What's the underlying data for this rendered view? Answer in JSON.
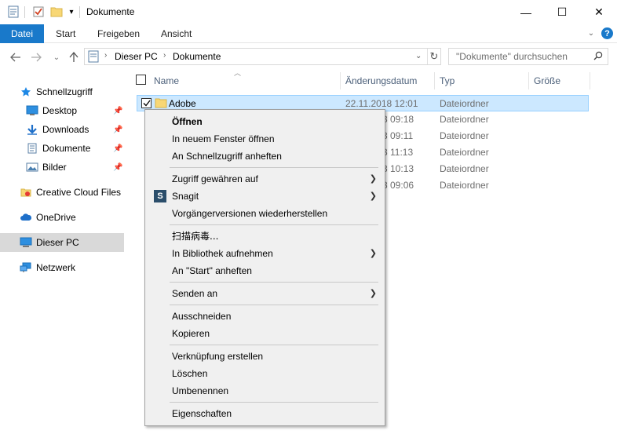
{
  "window": {
    "title": "Dokumente",
    "minimize": "—",
    "maximize": "☐",
    "close": "✕"
  },
  "ribbon": {
    "file": "Datei",
    "tabs": [
      "Start",
      "Freigeben",
      "Ansicht"
    ],
    "help": "?"
  },
  "address": {
    "segments": [
      "Dieser PC",
      "Dokumente"
    ],
    "search_placeholder": "\"Dokumente\" durchsuchen"
  },
  "sidebar": {
    "items": [
      {
        "label": "Schnellzugriff",
        "icon": "star-icon"
      },
      {
        "label": "Desktop",
        "icon": "desktop-icon",
        "pinned": true
      },
      {
        "label": "Downloads",
        "icon": "download-icon",
        "pinned": true
      },
      {
        "label": "Dokumente",
        "icon": "document-icon",
        "pinned": true
      },
      {
        "label": "Bilder",
        "icon": "pictures-icon",
        "pinned": true
      },
      {
        "label": "Creative Cloud Files",
        "icon": "creative-cloud-icon"
      },
      {
        "label": "OneDrive",
        "icon": "cloud-icon"
      },
      {
        "label": "Dieser PC",
        "icon": "computer-icon",
        "selected": true
      },
      {
        "label": "Netzwerk",
        "icon": "network-icon"
      }
    ]
  },
  "columns": {
    "name": "Name",
    "date": "Änderungsdatum",
    "type": "Typ",
    "size": "Größe"
  },
  "files": [
    {
      "name": "Adobe",
      "date": "22.11.2018 12:01",
      "type": "Dateiordner"
    },
    {
      "name": "",
      "date": "3 09:18",
      "type": "Dateiordner"
    },
    {
      "name": "",
      "date": "3 09:11",
      "type": "Dateiordner"
    },
    {
      "name": "",
      "date": "3 11:13",
      "type": "Dateiordner"
    },
    {
      "name": "",
      "date": "3 10:13",
      "type": "Dateiordner"
    },
    {
      "name": "",
      "date": "3 09:06",
      "type": "Dateiordner"
    }
  ],
  "context_menu": {
    "open": "Öffnen",
    "open_new_window": "In neuem Fenster öffnen",
    "pin_quick_access": "An Schnellzugriff anheften",
    "grant_access": "Zugriff gewähren auf",
    "snagit": "Snagit",
    "snagit_badge": "S",
    "restore_versions": "Vorgängerversionen wiederherstellen",
    "scan_virus": "扫描病毒...",
    "add_library": "In Bibliothek aufnehmen",
    "pin_start": "An \"Start\" anheften",
    "send_to": "Senden an",
    "cut": "Ausschneiden",
    "copy": "Kopieren",
    "create_shortcut": "Verknüpfung erstellen",
    "delete": "Löschen",
    "rename": "Umbenennen",
    "properties": "Eigenschaften"
  }
}
